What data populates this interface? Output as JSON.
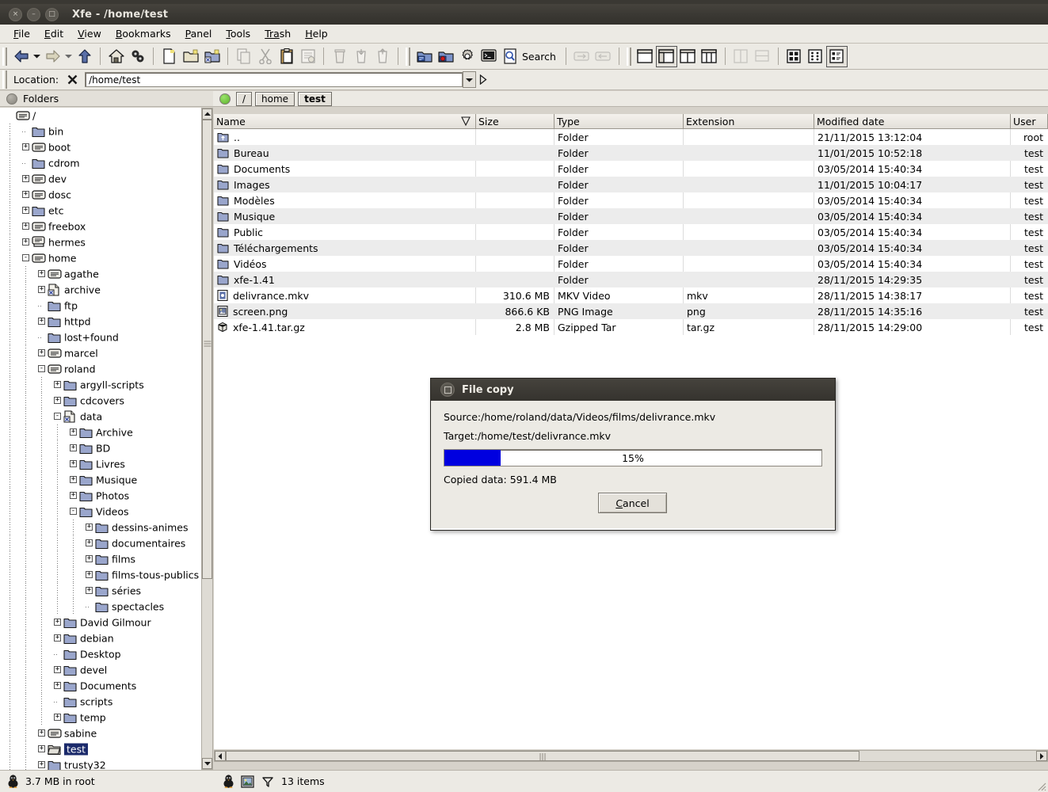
{
  "window": {
    "title": "Xfe - /home/test",
    "buttons": [
      {
        "name": "close",
        "glyph": "×"
      },
      {
        "name": "minimize",
        "glyph": "–"
      },
      {
        "name": "maximize",
        "glyph": "□"
      }
    ]
  },
  "menubar": [
    {
      "name": "file",
      "pre": "F",
      "mid": "ile",
      "post": ""
    },
    {
      "name": "edit",
      "pre": "E",
      "mid": "dit",
      "post": ""
    },
    {
      "name": "view",
      "pre": "V",
      "mid": "iew",
      "post": ""
    },
    {
      "name": "bookmarks",
      "pre": "B",
      "mid": "ookmarks",
      "post": ""
    },
    {
      "name": "panel",
      "pre": "P",
      "mid": "anel",
      "post": ""
    },
    {
      "name": "tools",
      "pre": "T",
      "mid": "ools",
      "post": ""
    },
    {
      "name": "trash",
      "pre": "Tra",
      "mid": "s",
      "post": "h"
    },
    {
      "name": "help",
      "pre": "H",
      "mid": "elp",
      "post": ""
    }
  ],
  "toolbar": {
    "search_label": "Search",
    "icons": [
      "back-icon",
      "back-dropdown-icon",
      "forward-icon",
      "forward-dropdown-icon",
      "up-icon",
      "home-icon",
      "work-dir-icon",
      "new-file-icon",
      "new-folder-icon",
      "new-symlink-icon",
      "copy-icon",
      "cut-icon",
      "paste-icon",
      "properties-icon",
      "delete-icon",
      "move-to-trash-icon",
      "restore-from-trash-icon",
      "mount-icon",
      "unmount-icon",
      "settings-icon",
      "terminal-icon",
      "search-icon",
      "refresh-icon",
      "sync-panels-icon",
      "one-panel-icon",
      "tree-panel-icon",
      "two-panels-icon",
      "tree-two-panels-icon",
      "horizontal-panels-icon",
      "vertical-panels-icon",
      "big-icons-icon",
      "small-icons-icon",
      "detail-list-icon"
    ]
  },
  "location": {
    "label": "Location:",
    "clear_icon": "clear-location-icon",
    "value": "/home/test",
    "placeholder": "/home/test",
    "dropdown_icon": "chevron-down-icon",
    "go_icon": "go-icon"
  },
  "left_panel": {
    "header": "Folders",
    "header_dot": "panel-status-dot-gray",
    "tree": [
      {
        "label": "/",
        "depth": 0,
        "icon": "drive",
        "toggle": "",
        "sel": false
      },
      {
        "label": "bin",
        "depth": 1,
        "icon": "folder",
        "toggle": "",
        "sel": false
      },
      {
        "label": "boot",
        "depth": 1,
        "icon": "drive",
        "toggle": "+",
        "sel": false
      },
      {
        "label": "cdrom",
        "depth": 1,
        "icon": "folder",
        "toggle": "",
        "sel": false
      },
      {
        "label": "dev",
        "depth": 1,
        "icon": "drive",
        "toggle": "+",
        "sel": false
      },
      {
        "label": "dosc",
        "depth": 1,
        "icon": "drive",
        "toggle": "+",
        "sel": false
      },
      {
        "label": "etc",
        "depth": 1,
        "icon": "folder",
        "toggle": "+",
        "sel": false
      },
      {
        "label": "freebox",
        "depth": 1,
        "icon": "drive",
        "toggle": "+",
        "sel": false
      },
      {
        "label": "hermes",
        "depth": 1,
        "icon": "net",
        "toggle": "+",
        "sel": false
      },
      {
        "label": "home",
        "depth": 1,
        "icon": "drive",
        "toggle": "-",
        "sel": false
      },
      {
        "label": "agathe",
        "depth": 2,
        "icon": "drive",
        "toggle": "+",
        "sel": false
      },
      {
        "label": "archive",
        "depth": 2,
        "icon": "link",
        "toggle": "+",
        "sel": false
      },
      {
        "label": "ftp",
        "depth": 2,
        "icon": "folder",
        "toggle": "",
        "sel": false
      },
      {
        "label": "httpd",
        "depth": 2,
        "icon": "folder",
        "toggle": "+",
        "sel": false
      },
      {
        "label": "lost+found",
        "depth": 2,
        "icon": "folder",
        "toggle": "",
        "sel": false
      },
      {
        "label": "marcel",
        "depth": 2,
        "icon": "drive",
        "toggle": "+",
        "sel": false
      },
      {
        "label": "roland",
        "depth": 2,
        "icon": "drive",
        "toggle": "-",
        "sel": false
      },
      {
        "label": "argyll-scripts",
        "depth": 3,
        "icon": "folder",
        "toggle": "+",
        "sel": false
      },
      {
        "label": "cdcovers",
        "depth": 3,
        "icon": "folder",
        "toggle": "+",
        "sel": false
      },
      {
        "label": "data",
        "depth": 3,
        "icon": "link",
        "toggle": "-",
        "sel": false
      },
      {
        "label": "Archive",
        "depth": 4,
        "icon": "folder",
        "toggle": "+",
        "sel": false
      },
      {
        "label": "BD",
        "depth": 4,
        "icon": "folder",
        "toggle": "+",
        "sel": false
      },
      {
        "label": "Livres",
        "depth": 4,
        "icon": "folder",
        "toggle": "+",
        "sel": false
      },
      {
        "label": "Musique",
        "depth": 4,
        "icon": "folder",
        "toggle": "+",
        "sel": false
      },
      {
        "label": "Photos",
        "depth": 4,
        "icon": "folder",
        "toggle": "+",
        "sel": false
      },
      {
        "label": "Videos",
        "depth": 4,
        "icon": "folder",
        "toggle": "-",
        "sel": false
      },
      {
        "label": "dessins-animes",
        "depth": 5,
        "icon": "folder",
        "toggle": "+",
        "sel": false
      },
      {
        "label": "documentaires",
        "depth": 5,
        "icon": "folder",
        "toggle": "+",
        "sel": false
      },
      {
        "label": "films",
        "depth": 5,
        "icon": "folder",
        "toggle": "+",
        "sel": false
      },
      {
        "label": "films-tous-publics",
        "depth": 5,
        "icon": "folder",
        "toggle": "+",
        "sel": false
      },
      {
        "label": "séries",
        "depth": 5,
        "icon": "folder",
        "toggle": "+",
        "sel": false
      },
      {
        "label": "spectacles",
        "depth": 5,
        "icon": "folder",
        "toggle": "",
        "sel": false
      },
      {
        "label": "David Gilmour",
        "depth": 3,
        "icon": "folder",
        "toggle": "+",
        "sel": false
      },
      {
        "label": "debian",
        "depth": 3,
        "icon": "folder",
        "toggle": "+",
        "sel": false
      },
      {
        "label": "Desktop",
        "depth": 3,
        "icon": "folder",
        "toggle": "",
        "sel": false
      },
      {
        "label": "devel",
        "depth": 3,
        "icon": "folder",
        "toggle": "+",
        "sel": false
      },
      {
        "label": "Documents",
        "depth": 3,
        "icon": "folder",
        "toggle": "+",
        "sel": false
      },
      {
        "label": "scripts",
        "depth": 3,
        "icon": "folder",
        "toggle": "",
        "sel": false
      },
      {
        "label": "temp",
        "depth": 3,
        "icon": "folder",
        "toggle": "+",
        "sel": false
      },
      {
        "label": "sabine",
        "depth": 2,
        "icon": "drive",
        "toggle": "+",
        "sel": false
      },
      {
        "label": "test",
        "depth": 2,
        "icon": "openfolder",
        "toggle": "+",
        "sel": true
      },
      {
        "label": "trusty32",
        "depth": 2,
        "icon": "folder",
        "toggle": "+",
        "sel": false
      }
    ]
  },
  "right_panel": {
    "header_dot": "panel-status-dot-green",
    "breadcrumbs": [
      {
        "label": "/",
        "bold": false
      },
      {
        "label": "home",
        "bold": false
      },
      {
        "label": "test",
        "bold": true
      }
    ],
    "columns": [
      {
        "key": "name",
        "label": "Name",
        "sorted": true
      },
      {
        "key": "size",
        "label": "Size",
        "sorted": false
      },
      {
        "key": "type",
        "label": "Type",
        "sorted": false
      },
      {
        "key": "ext",
        "label": "Extension",
        "sorted": false
      },
      {
        "key": "modified",
        "label": "Modified date",
        "sorted": false
      },
      {
        "key": "user",
        "label": "User",
        "sorted": false
      }
    ],
    "rows": [
      {
        "icon": "folder-up",
        "name": "..",
        "size": "",
        "type": "Folder",
        "ext": "",
        "modified": "21/11/2015 13:12:04",
        "user": "root"
      },
      {
        "icon": "folder",
        "name": "Bureau",
        "size": "",
        "type": "Folder",
        "ext": "",
        "modified": "11/01/2015 10:52:18",
        "user": "test"
      },
      {
        "icon": "folder",
        "name": "Documents",
        "size": "",
        "type": "Folder",
        "ext": "",
        "modified": "03/05/2014 15:40:34",
        "user": "test"
      },
      {
        "icon": "folder",
        "name": "Images",
        "size": "",
        "type": "Folder",
        "ext": "",
        "modified": "11/01/2015 10:04:17",
        "user": "test"
      },
      {
        "icon": "folder",
        "name": "Modèles",
        "size": "",
        "type": "Folder",
        "ext": "",
        "modified": "03/05/2014 15:40:34",
        "user": "test"
      },
      {
        "icon": "folder",
        "name": "Musique",
        "size": "",
        "type": "Folder",
        "ext": "",
        "modified": "03/05/2014 15:40:34",
        "user": "test"
      },
      {
        "icon": "folder",
        "name": "Public",
        "size": "",
        "type": "Folder",
        "ext": "",
        "modified": "03/05/2014 15:40:34",
        "user": "test"
      },
      {
        "icon": "folder",
        "name": "Téléchargements",
        "size": "",
        "type": "Folder",
        "ext": "",
        "modified": "03/05/2014 15:40:34",
        "user": "test"
      },
      {
        "icon": "folder",
        "name": "Vidéos",
        "size": "",
        "type": "Folder",
        "ext": "",
        "modified": "03/05/2014 15:40:34",
        "user": "test"
      },
      {
        "icon": "folder",
        "name": "xfe-1.41",
        "size": "",
        "type": "Folder",
        "ext": "",
        "modified": "28/11/2015 14:29:35",
        "user": "test"
      },
      {
        "icon": "video",
        "name": "delivrance.mkv",
        "size": "310.6 MB",
        "type": "MKV Video",
        "ext": "mkv",
        "modified": "28/11/2015 14:38:17",
        "user": "test"
      },
      {
        "icon": "image",
        "name": "screen.png",
        "size": "866.6 KB",
        "type": "PNG Image",
        "ext": "png",
        "modified": "28/11/2015 14:35:16",
        "user": "test"
      },
      {
        "icon": "archive",
        "name": "xfe-1.41.tar.gz",
        "size": "2.8 MB",
        "type": "Gzipped Tar",
        "ext": "tar.gz",
        "modified": "28/11/2015 14:29:00",
        "user": "test"
      }
    ]
  },
  "statusbar": {
    "left_icon": "linux-penguin-icon",
    "left_text": "3.7 MB in root",
    "right_icons": [
      "linux-penguin-icon",
      "thumbnails-icon",
      "filter-icon"
    ],
    "right_text": "13 items"
  },
  "dialog": {
    "title": "File copy",
    "title_icon": "dialog-window-icon",
    "source_label": "Source:",
    "source_value": "/home/roland/data/Videos/films/delivrance.mkv",
    "target_label": "Target:",
    "target_value": "/home/test/delivrance.mkv",
    "progress_percent_text": "15%",
    "progress_percent": 15,
    "copied_label": "Copied data:",
    "copied_value": "591.4 MB",
    "cancel_pre": "C",
    "cancel_post": "ancel"
  },
  "colors": {
    "accent_progress": "#0000e0",
    "selection": "#1b2a6b",
    "chrome": "#eceae4",
    "titlebar": "#3a3833",
    "row_alt": "#ececec",
    "status_green": "#5cb22c"
  }
}
